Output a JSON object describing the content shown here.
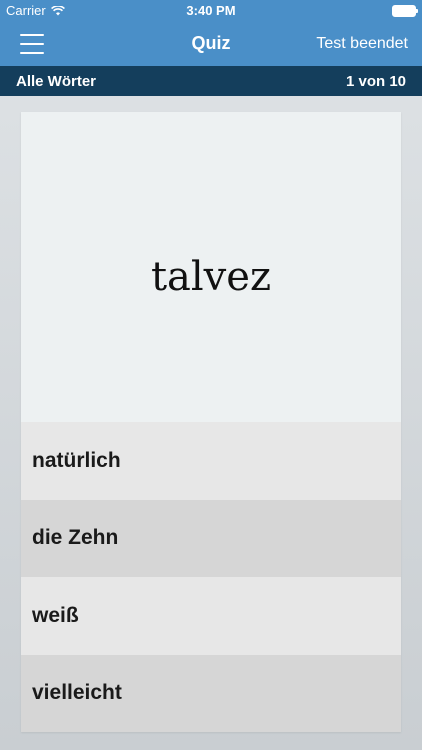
{
  "status_bar": {
    "carrier": "Carrier",
    "time": "3:40 PM"
  },
  "nav": {
    "title": "Quiz",
    "action_label": "Test beendet"
  },
  "sub_header": {
    "category": "Alle Wörter",
    "progress": "1 von 10"
  },
  "quiz": {
    "question_word": "talvez",
    "answers": [
      {
        "label": "natürlich"
      },
      {
        "label": "die Zehn"
      },
      {
        "label": "weiß"
      },
      {
        "label": "vielleicht"
      }
    ]
  },
  "colors": {
    "nav_background": "#4a8fc8",
    "sub_header_background": "#143e5c",
    "card_background": "#edf1f2"
  }
}
